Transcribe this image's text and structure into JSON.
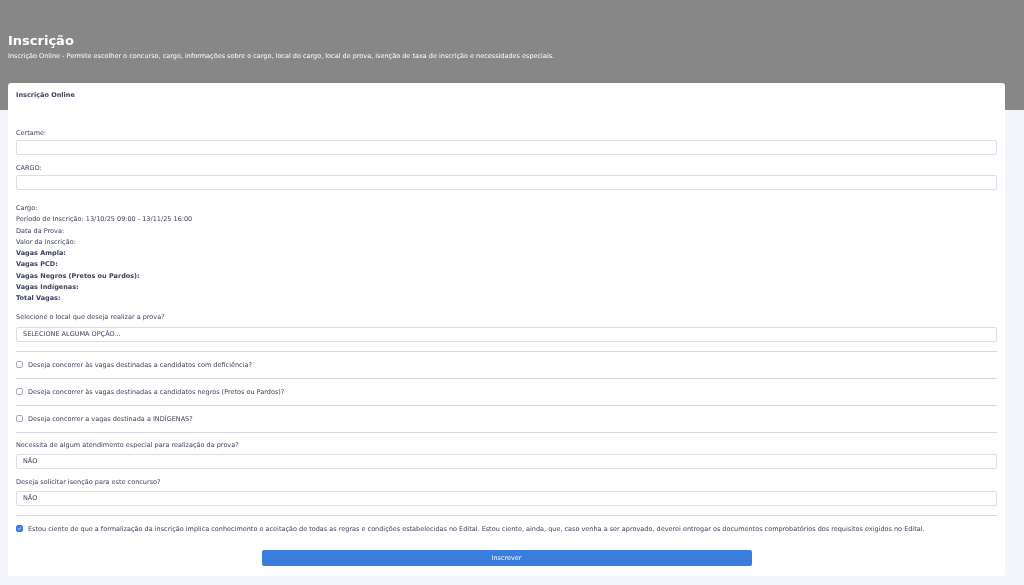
{
  "header": {
    "title": "Inscrição",
    "subtitle": "Inscrição Online - Permite escolher o concurso, cargo, informações sobre o cargo, local do cargo, local de prova, isenção de taxa de inscrição e necessidades especiais."
  },
  "card": {
    "title": "Inscrição Online"
  },
  "fields_top": [
    {
      "label": "Certame:"
    },
    {
      "label": "CARGO:"
    }
  ],
  "info": [
    {
      "text": "Cargo:",
      "bold": false
    },
    {
      "text": "Período de Inscrição: 13/10/25 09:00 - 13/11/25 16:00",
      "bold": false
    },
    {
      "text": "Data da Prova:",
      "bold": false
    },
    {
      "text": "Valor da Inscrição:",
      "bold": false
    },
    {
      "text": "Vagas Ampla:",
      "bold": true
    },
    {
      "text": "Vagas PCD:",
      "bold": true
    },
    {
      "text": "Vagas Negros (Pretos ou Pardos):",
      "bold": true
    },
    {
      "text": "Vagas Indígenas:",
      "bold": true
    },
    {
      "text": "Total Vagas:",
      "bold": true
    }
  ],
  "location": {
    "label": "Selecione o local que deseja realizar a prova?",
    "value": "SELECIONE ALGUMA OPÇÃO..."
  },
  "checkboxes": [
    {
      "label": "Deseja concorrer às vagas destinadas a candidatos com deficiência?",
      "checked": false
    },
    {
      "label": "Deseja concorrer às vagas destinadas a candidatos negros (Pretos ou Pardos)?",
      "checked": false
    },
    {
      "label": "Deseja concorrer a vagas destinada a INDÍGENAS?",
      "checked": false
    }
  ],
  "selects": [
    {
      "label": "Necessita de algum atendimento especial para realização da prova?",
      "value": "NÃO"
    },
    {
      "label": "Deseja solicitar isenção para este concurso?",
      "value": "NÃO"
    }
  ],
  "agreement": {
    "label": "Estou ciente de que a formalização da inscrição implica conhecimento e aceitação de todas as regras e condições estabelecidas no Edital. Estou ciente, ainda, que, caso venha a ser aprovado, deverei entregar os documentos comprobatórios dos requisitos exigidos no Edital.",
    "checked": true
  },
  "submit": {
    "label": "Inscrever"
  }
}
